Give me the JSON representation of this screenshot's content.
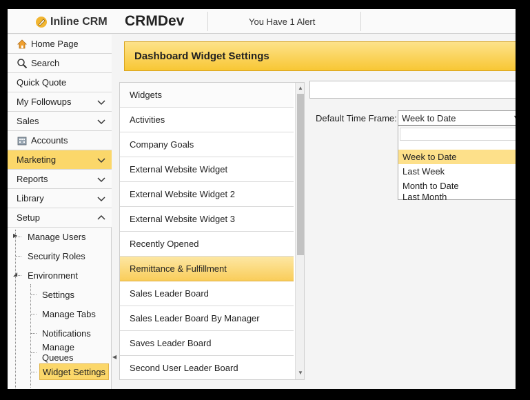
{
  "header": {
    "app_name": "Inline CRM",
    "org_name": "CRMDev",
    "alert_text": "You Have 1 Alert"
  },
  "sidebar": {
    "items": [
      {
        "label": "Home Page",
        "icon": "home-icon"
      },
      {
        "label": "Search",
        "icon": "search-icon"
      },
      {
        "label": "Quick Quote"
      },
      {
        "label": "My Followups",
        "chevron": "down"
      },
      {
        "label": "Sales",
        "chevron": "down"
      },
      {
        "label": "Accounts",
        "icon": "building-icon"
      },
      {
        "label": "Marketing",
        "chevron": "down",
        "active": true
      },
      {
        "label": "Reports",
        "chevron": "down"
      },
      {
        "label": "Library",
        "chevron": "down"
      },
      {
        "label": "Setup",
        "chevron": "up"
      }
    ],
    "setup_tree": {
      "manage_users": "Manage Users",
      "security_roles": "Security Roles",
      "environment": "Environment",
      "settings": "Settings",
      "manage_tabs": "Manage Tabs",
      "notifications": "Notifications",
      "manage_queues": "Manage Queues",
      "widget_settings": "Widget Settings"
    }
  },
  "main": {
    "title": "Dashboard Widget Settings",
    "widgets_header": "Widgets",
    "widgets": [
      "Activities",
      "Company Goals",
      "External Website Widget",
      "External Website Widget 2",
      "External Website Widget 3",
      "Recently Opened",
      "Remittance & Fulfillment",
      "Sales Leader Board",
      "Sales Leader Board By Manager",
      "Saves Leader Board",
      "Second User Leader Board"
    ],
    "selected_widget": "Remittance & Fulfillment",
    "time_frame": {
      "label": "Default Time Frame:",
      "selected": "Week to Date",
      "options": [
        "Week to Date",
        "Last Week",
        "Month to Date",
        "Last Month"
      ]
    }
  },
  "colors": {
    "accent": "#fbd76a",
    "banner_top": "#fde28a",
    "banner_bottom": "#f8c734",
    "frame": "#000000"
  }
}
